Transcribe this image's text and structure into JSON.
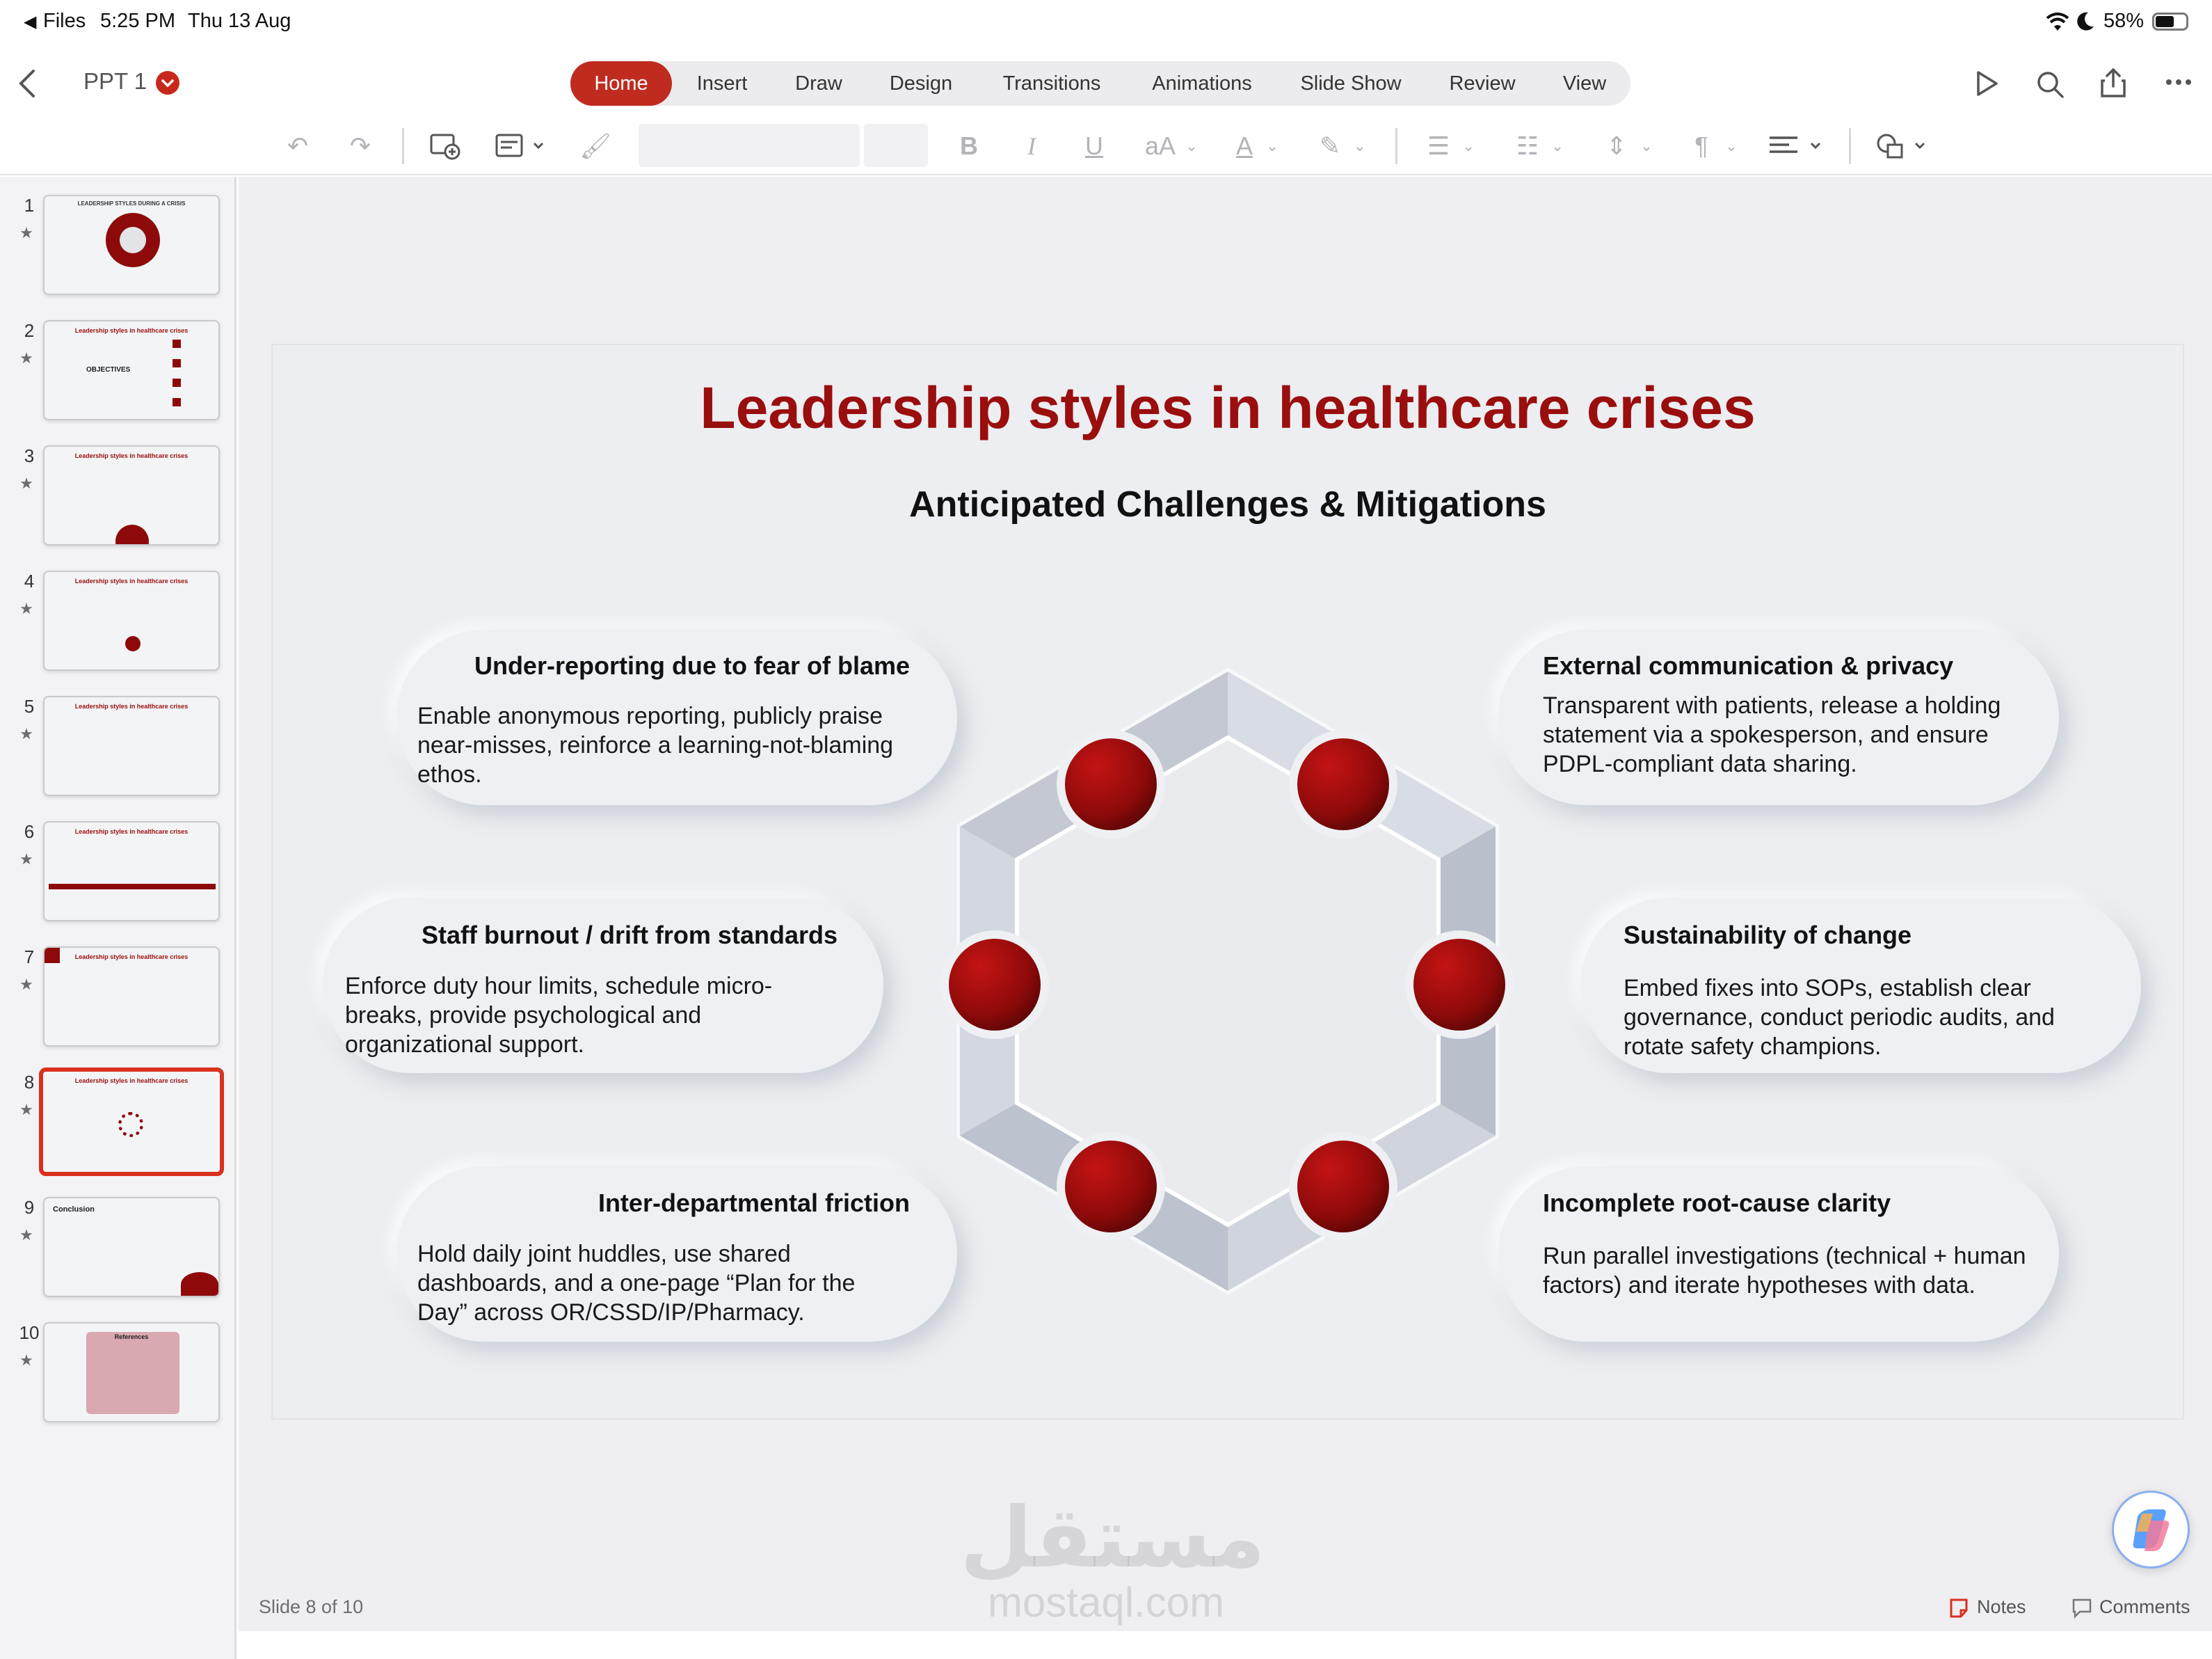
{
  "status_bar": {
    "back_app": "Files",
    "time": "5:25 PM",
    "date": "Thu 13 Aug",
    "battery": "58%"
  },
  "document": {
    "title": "PPT 1"
  },
  "ribbon_tabs": [
    "Home",
    "Insert",
    "Draw",
    "Design",
    "Transitions",
    "Animations",
    "Slide Show",
    "Review",
    "View"
  ],
  "active_tab": "Home",
  "toolbar": {
    "bold": "B",
    "italic": "I",
    "underline": "U",
    "font_size_label": "aA",
    "font_color_label": "A"
  },
  "slides": [
    {
      "number": "1",
      "title": "LEADERSHIP STYLES DURING A CRISIS"
    },
    {
      "number": "2",
      "title": "Leadership styles in healthcare crises",
      "label": "OBJECTIVES"
    },
    {
      "number": "3",
      "title": "Leadership styles in healthcare crises"
    },
    {
      "number": "4",
      "title": "Leadership styles in healthcare crises"
    },
    {
      "number": "5",
      "title": "Leadership styles in healthcare crises"
    },
    {
      "number": "6",
      "title": "Leadership styles in healthcare crises"
    },
    {
      "number": "7",
      "title": "Leadership styles in healthcare crises"
    },
    {
      "number": "8",
      "title": "Leadership styles in healthcare crises"
    },
    {
      "number": "9",
      "title": "Conclusion"
    },
    {
      "number": "10",
      "title": "References"
    }
  ],
  "selected_slide": 8,
  "slide": {
    "title": "Leadership styles in healthcare crises",
    "subtitle": "Anticipated Challenges & Mitigations",
    "cards": [
      {
        "heading": "Under-reporting due to fear of blame",
        "body": "Enable anonymous reporting, publicly praise near-misses, reinforce a learning-not-blaming ethos."
      },
      {
        "heading": "Staff burnout / drift from standards",
        "body": "Enforce duty hour limits, schedule micro-breaks, provide psychological and organizational support."
      },
      {
        "heading": "Inter-departmental friction",
        "body": "Hold daily joint huddles, use shared dashboards, and a one-page “Plan for the Day” across OR/CSSD/IP/Pharmacy."
      },
      {
        "heading": "External communication & privacy",
        "body": "Transparent with patients, release a holding statement via a spokesperson, and ensure PDPL-compliant data sharing."
      },
      {
        "heading": "Sustainability of change",
        "body": "Embed fixes into SOPs, establish clear governance, conduct periodic audits, and rotate safety champions."
      },
      {
        "heading": "Incomplete root-cause clarity",
        "body": "Run parallel investigations (technical + human factors) and iterate hypotheses with data."
      }
    ]
  },
  "footer": {
    "slide_counter": "Slide 8 of 10",
    "notes": "Notes",
    "comments": "Comments",
    "watermark_domain": "mostaql.com",
    "watermark_arabic": "مستقل"
  },
  "colors": {
    "accent": "#bf2c1f",
    "title_red": "#9a0e0e",
    "node_red": "#8e0a0a"
  }
}
